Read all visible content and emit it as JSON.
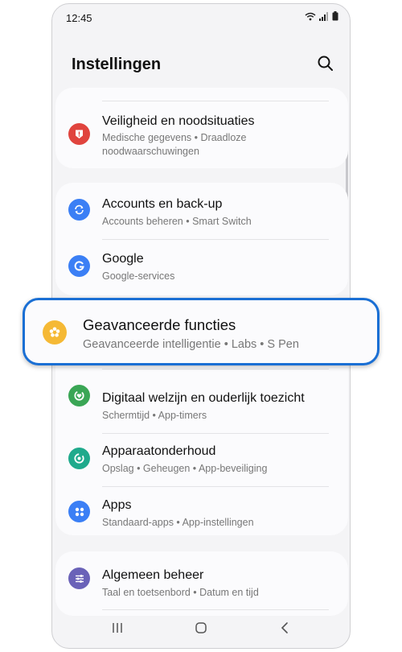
{
  "status_bar": {
    "time": "12:45"
  },
  "header": {
    "title": "Instellingen"
  },
  "rows": {
    "safety": {
      "title": "Veiligheid en noodsituaties",
      "sub1": "Medische gegevens • Draadloze",
      "sub2": "noodwaarschuwingen",
      "color": "#e0443e"
    },
    "accounts": {
      "title": "Accounts en back-up",
      "sub": "Accounts beheren • Smart Switch",
      "color": "#3b7ff5"
    },
    "google": {
      "title": "Google",
      "sub": "Google-services",
      "color": "#3b7ff5"
    },
    "wellbeing": {
      "title": "Digitaal welzijn en ouderlijk toezicht",
      "sub": "Schermtijd • App-timers",
      "color": "#3aa655"
    },
    "care": {
      "title": "Apparaatonderhoud",
      "sub": "Opslag • Geheugen • App-beveiliging",
      "color": "#1faa8c"
    },
    "apps": {
      "title": "Apps",
      "sub": "Standaard-apps • App-instellingen",
      "color": "#3b7ff5"
    },
    "general": {
      "title": "Algemeen beheer",
      "sub": "Taal en toetsenbord • Datum en tijd",
      "color": "#6a62b8"
    }
  },
  "highlight": {
    "title": "Geavanceerde functies",
    "sub": "Geavanceerde intelligentie • Labs • S Pen",
    "color": "#f5b935",
    "accent": "#1a6fd4"
  }
}
